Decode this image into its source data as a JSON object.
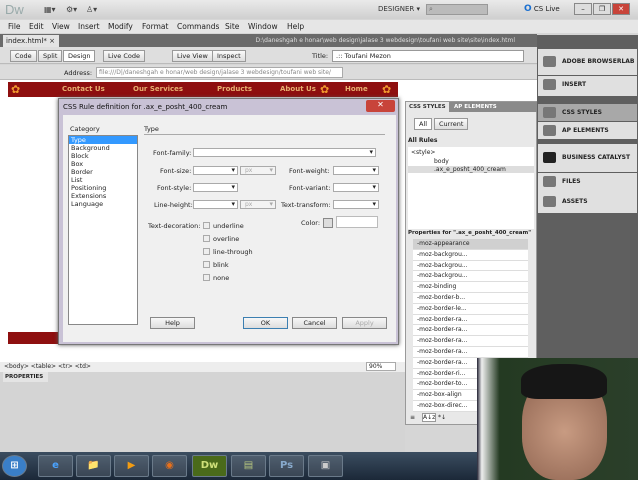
{
  "app": {
    "logo": "Dw",
    "workspace": "DESIGNER ▾",
    "search_placeholder": "⌕",
    "cs_live": "CS Live",
    "win_buttons": [
      "–",
      "❐",
      "✕"
    ],
    "toolbar_icons": [
      "▦▾",
      "⚙▾",
      "♙▾"
    ]
  },
  "menu": [
    "File",
    "Edit",
    "View",
    "Insert",
    "Modify",
    "Format",
    "Commands",
    "Site",
    "Window",
    "Help"
  ],
  "document": {
    "tab": "index.html*",
    "tab_close": "×",
    "path": "D:\\daneshgah e honar\\web design\\jalase 3 webdesign\\toufani web site\\site\\index.html"
  },
  "toolbar": {
    "code": "Code",
    "split": "Split",
    "design": "Design",
    "live_code": "Live Code",
    "live_view": "Live View",
    "inspect": "Inspect",
    "title_label": "Title:",
    "title_value": ".:: Toufani Mezon"
  },
  "address": {
    "label": "Address:",
    "value": "file:///D|/daneshgah e honar/web design/jalase 3 webdesign/toufani web site/"
  },
  "page_nav": [
    "Contact Us",
    "Our Services",
    "Products",
    "About Us",
    "Home"
  ],
  "dialog": {
    "title": "CSS Rule definition for .ax_e_posht_400_cream",
    "close": "✕",
    "category_label": "Category",
    "section": "Type",
    "categories": [
      "Type",
      "Background",
      "Block",
      "Box",
      "Border",
      "List",
      "Positioning",
      "Extensions",
      "Language"
    ],
    "selected_category": "Type",
    "fields": {
      "font_family": "Font-family:",
      "font_size": "Font-size:",
      "font_weight": "Font-weight:",
      "font_style": "Font-style:",
      "font_variant": "Font-variant:",
      "line_height": "Line-height:",
      "text_transform": "Text-transform:",
      "text_decoration": "Text-decoration:",
      "color": "Color:",
      "unit": "px"
    },
    "decorations": [
      "underline",
      "overline",
      "line-through",
      "blink",
      "none"
    ],
    "buttons": {
      "help": "Help",
      "ok": "OK",
      "cancel": "Cancel",
      "apply": "Apply"
    }
  },
  "css_panel": {
    "tabs": [
      "CSS STYLES",
      "AP ELEMENTS"
    ],
    "modes": [
      "All",
      "Current"
    ],
    "all_rules": "All Rules",
    "rules": [
      "<style>",
      "body",
      ".ax_e_posht_400_cream"
    ],
    "properties_title": "Properties for \".ax_e_posht_400_cream\"",
    "properties": [
      "-moz-appearance",
      "-moz-backgrou...",
      "-moz-backgrou...",
      "-moz-backgrou...",
      "-moz-binding",
      "-moz-border-b...",
      "-moz-border-le...",
      "-moz-border-ra...",
      "-moz-border-ra...",
      "-moz-border-ra...",
      "-moz-border-ra...",
      "-moz-border-ra...",
      "-moz-border-ri...",
      "-moz-border-to...",
      "-moz-box-align",
      "-moz-box-direc..."
    ],
    "bottom_icons": [
      "≡",
      "A↓z",
      "*↓"
    ]
  },
  "dock": [
    "ADOBE BROWSERLAB",
    "INSERT",
    "CSS STYLES",
    "AP ELEMENTS",
    "BUSINESS CATALYST",
    "FILES",
    "ASSETS"
  ],
  "status": {
    "tags": "<body> <table> <tr> <td>",
    "zoom": "90%"
  },
  "properties_panel": {
    "tab": "PROPERTIES"
  },
  "taskbar": [
    "⊞",
    "e",
    "📁",
    "▶",
    "◉",
    "Dw",
    "▤",
    "Ps",
    "▣"
  ],
  "colors": {
    "nav_red": "#8e0f0f",
    "selection": "#3399ff",
    "dock": "#5f5f5f"
  }
}
